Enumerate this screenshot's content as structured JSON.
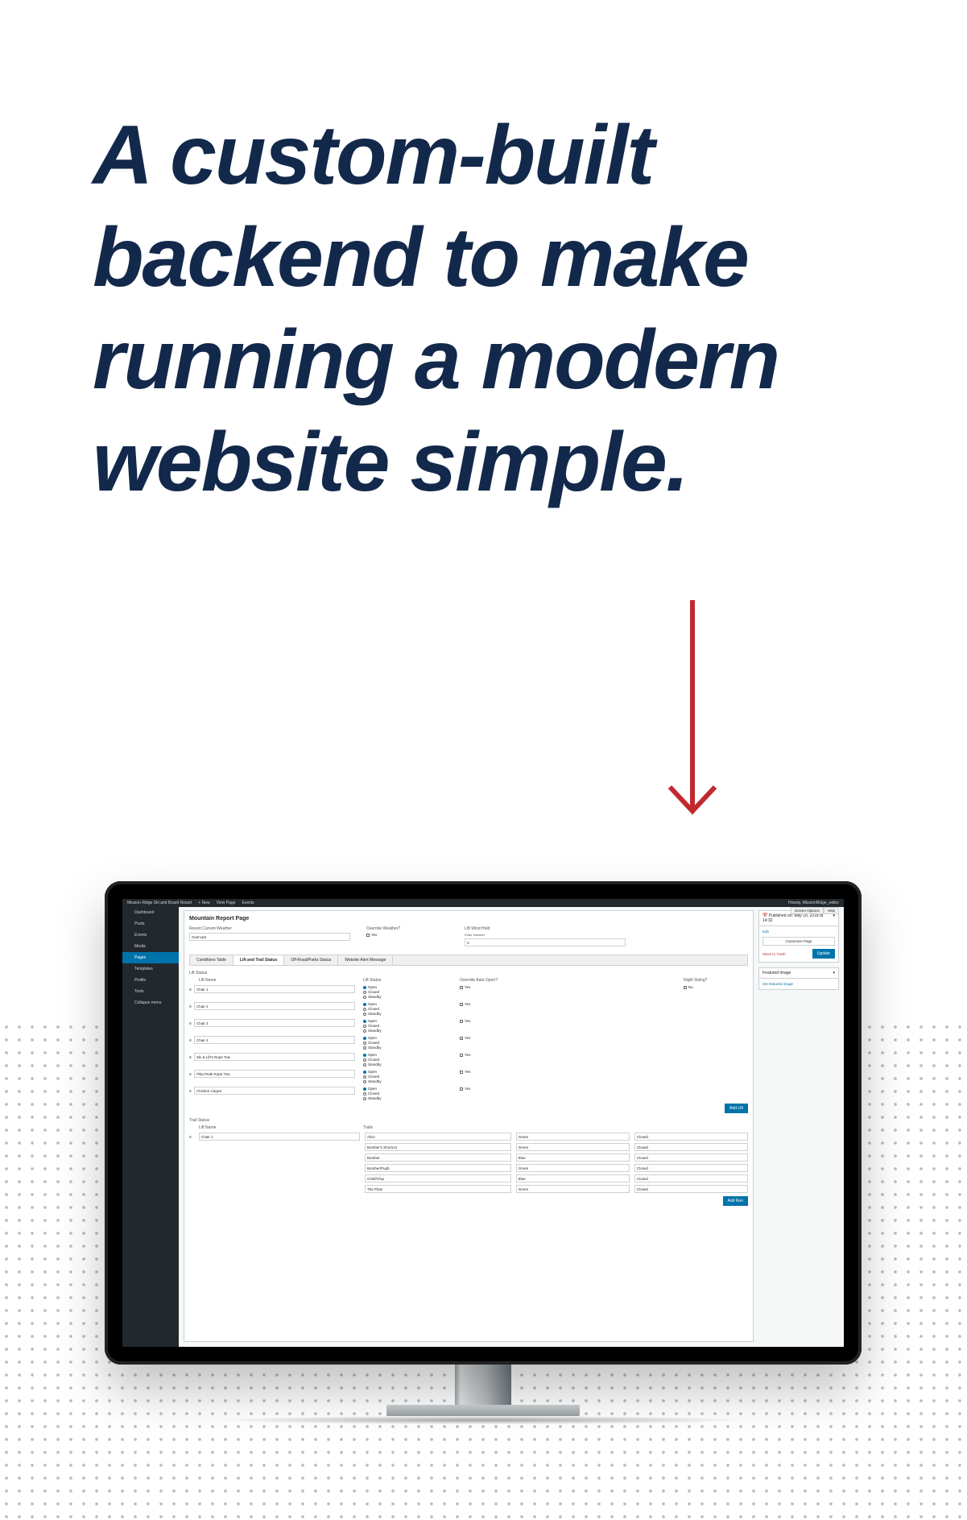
{
  "headline": "A custom-built backend to make running a modern website simple.",
  "arrow_color": "#c2292e",
  "wp": {
    "adminbar": {
      "site_name": "Mission Ridge Ski and Board Resort",
      "items": [
        "New",
        "View Page",
        "Events"
      ],
      "howdy": "Howdy, MissionRidge_editor"
    },
    "sidebar": [
      {
        "label": "Dashboard"
      },
      {
        "label": "Posts"
      },
      {
        "label": "Events"
      },
      {
        "label": "Media"
      },
      {
        "label": "Pages",
        "active": true
      },
      {
        "label": "Templates"
      },
      {
        "label": "Profile"
      },
      {
        "label": "Tools"
      },
      {
        "label": "Collapse menu"
      }
    ],
    "page_title": "Mountain Report Page",
    "top_fields": {
      "current_weather_label": "Resort Current Weather",
      "current_weather_value": "Overcast",
      "override_label": "Override Weather?",
      "override_option": "Yes",
      "wind_label": "Lift Wind Hold",
      "wind_sublabel": "Enter Number",
      "wind_value": "0"
    },
    "tabs": [
      "Conditions Table",
      "Lift and Trail Status",
      "Off-Road/Parks Status",
      "Website Alert Message"
    ],
    "lift_section_label": "Lift Status",
    "lift_col_name": "Lift Name",
    "lift_col_status": "Lift Status",
    "lift_col_haul": "Override Auto Open?",
    "lift_col_night": "Night Skiing?",
    "night_no_label": "No",
    "status_options": [
      "Open",
      "Closed",
      "Standby"
    ],
    "haul_option": "Yes",
    "lifts": [
      {
        "name": "Chair 1",
        "status": "Open"
      },
      {
        "name": "Chair 2",
        "status": "Open"
      },
      {
        "name": "Chair 3",
        "status": "Open"
      },
      {
        "name": "Chair 4",
        "status": "Open"
      },
      {
        "name": "Ski & Lift's Rope Tow",
        "status": "Open"
      },
      {
        "name": "Pika Peak Rope Tow",
        "status": "Open"
      },
      {
        "name": "Chicken Carpet",
        "status": "Open"
      }
    ],
    "add_lift_label": "Add Lift",
    "trail_section_label": "Trail Status",
    "trail_col_name": "Lift Name",
    "trail_col_trails": "Trails",
    "trail_block_lift": "Chair 1",
    "trails": [
      {
        "name": "Alice",
        "diff": "Green",
        "status": "Closed"
      },
      {
        "name": "Bomber's Shortcut",
        "diff": "Green",
        "status": "Closed"
      },
      {
        "name": "Bomber",
        "diff": "Blue",
        "status": "Closed"
      },
      {
        "name": "Bomber/Pugh",
        "diff": "Green",
        "status": "Closed"
      },
      {
        "name": "Chief/Chip",
        "diff": "Blue",
        "status": "Closed"
      },
      {
        "name": "The Plute",
        "diff": "Green",
        "status": "Closed"
      }
    ],
    "add_run_label": "Add Run",
    "publish_box": {
      "title_prefix": "Published on:",
      "title_date": "May 18, 2018 at 14:32",
      "edit": "Edit",
      "custom_btn": "Customize Page",
      "trash": "Move to Trash",
      "update": "Update"
    },
    "featured_box": {
      "title": "Featured Image",
      "link": "Set featured image"
    },
    "screen_options": [
      "Screen Options",
      "Help"
    ]
  }
}
